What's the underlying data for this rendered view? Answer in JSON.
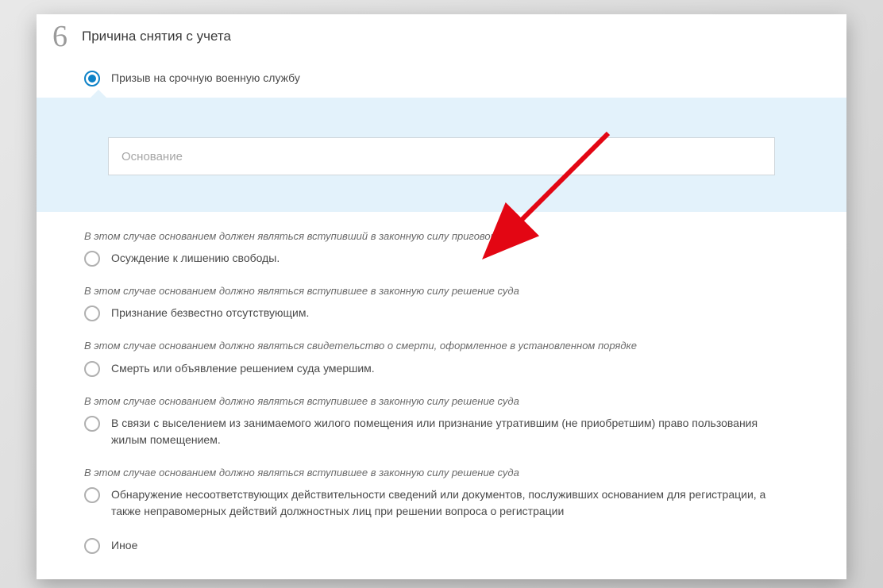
{
  "step_number": "6",
  "section_title": "Причина снятия с учета",
  "input": {
    "placeholder": "Основание",
    "value": ""
  },
  "options": [
    {
      "note": "",
      "label": "Призыв на срочную военную службу",
      "selected": true
    },
    {
      "note": "В этом случае основанием должен являться вступивший в законную силу приговор суда",
      "label": "Осуждение к лишению свободы.",
      "selected": false
    },
    {
      "note": "В этом случае основанием должно являться вступившее в законную силу решение суда",
      "label": "Признание безвестно отсутствующим.",
      "selected": false
    },
    {
      "note": "В этом случае основанием должно являться свидетельство о смерти, оформленное в установленном порядке",
      "label": "Смерть или объявление решением суда умершим.",
      "selected": false
    },
    {
      "note": "В этом случае основанием должно являться вступившее в законную силу решение суда",
      "label": "В связи с выселением из занимаемого жилого помещения или признание утратившим (не приобретшим) право пользования жилым помещением.",
      "selected": false
    },
    {
      "note": "В этом случае основанием должно являться вступившее в законную силу решение суда",
      "label": "Обнаружение несоответствующих действительности сведений или документов, послуживших основанием для регистрации, а также неправомерных действий должностных лиц при решении вопроса о регистрации",
      "selected": false
    },
    {
      "note": "",
      "label": "Иное",
      "selected": false
    }
  ]
}
